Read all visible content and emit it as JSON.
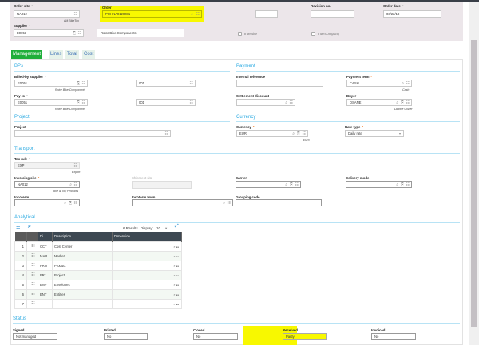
{
  "header": {
    "order_site": {
      "label": "Order site",
      "value": "NA012",
      "sub": "AM BikeToy"
    },
    "order": {
      "label": "Order",
      "value": "POHNA0120081"
    },
    "revision": {
      "label": "Revision no.",
      "value": ""
    },
    "order_date": {
      "label": "Order date",
      "value": "03/22/18"
    },
    "supplier": {
      "label": "Supplier",
      "value": "E0051",
      "name": "Rotor Bike Components"
    },
    "intersite": "Intersite",
    "intercompany": "Intercompany"
  },
  "tabs": [
    "Management",
    "Lines",
    "Total",
    "Cost"
  ],
  "bps": {
    "title": "BPs",
    "billed_by": {
      "label": "Billed-by supplier",
      "value": "E0051",
      "addr": "001",
      "sub": "Rotor Bike Components"
    },
    "pay_to": {
      "label": "Pay-to",
      "value": "E0051",
      "addr": "001",
      "sub": "Rotor Bike Components"
    }
  },
  "payment": {
    "title": "Payment",
    "internal_ref": {
      "label": "Internal reference",
      "value": ""
    },
    "payment_term": {
      "label": "Payment term",
      "value": "CASH",
      "sub": "Cash"
    },
    "settlement": {
      "label": "Settlement discount",
      "value": ""
    },
    "buyer": {
      "label": "Buyer",
      "value": "DSANE",
      "sub": "Dianne Olivier"
    }
  },
  "project": {
    "title": "Project",
    "label": "Project",
    "value": ""
  },
  "currency": {
    "title": "Currency",
    "currency": {
      "label": "Currency",
      "value": "EUR",
      "sub": "Euro"
    },
    "rate_type": {
      "label": "Rate type",
      "value": "Daily rate"
    }
  },
  "transport": {
    "title": "Transport",
    "tax_rule": {
      "label": "Tax rule",
      "value": "EXP",
      "sub": "Export"
    },
    "invoicing_site": {
      "label": "Invoicing site",
      "value": "NA012",
      "sub": "Bike & Toy Products"
    },
    "shipment_site": {
      "label": "Shipment site",
      "value": ""
    },
    "carrier": {
      "label": "Carrier",
      "value": ""
    },
    "delivery_mode": {
      "label": "Delivery mode",
      "value": ""
    },
    "incoterm": {
      "label": "Incoterm",
      "value": ""
    },
    "incoterm_town": {
      "label": "Incoterm town",
      "value": ""
    },
    "grouping_code": {
      "label": "Grouping code",
      "value": ""
    }
  },
  "analytical": {
    "title": "Analytical",
    "results": "6 Results",
    "display_label": "Display:",
    "display_value": "10",
    "columns": [
      "Di...",
      "Description",
      "Dimension"
    ],
    "rows": [
      [
        "1",
        "CCT",
        "Cost Center"
      ],
      [
        "2",
        "MAR",
        "Market"
      ],
      [
        "3",
        "PRO",
        "Product"
      ],
      [
        "4",
        "PRJ",
        "Project"
      ],
      [
        "5",
        "ENV",
        "Envelopes"
      ],
      [
        "6",
        "ENT",
        "Entities"
      ],
      [
        "7",
        "",
        ""
      ]
    ]
  },
  "status": {
    "title": "Status",
    "signed": {
      "label": "Signed",
      "value": "Not managed"
    },
    "printed": {
      "label": "Printed",
      "value": "No"
    },
    "closed": {
      "label": "Closed",
      "value": "No"
    },
    "received": {
      "label": "Received",
      "value": "Partly"
    },
    "invoiced": {
      "label": "Invoiced",
      "value": "No"
    }
  },
  "colors": {
    "tab_active": "#1fae3a",
    "section": "#29a9e1",
    "highlight": "#f8f800",
    "table_header": "#3d4852"
  }
}
